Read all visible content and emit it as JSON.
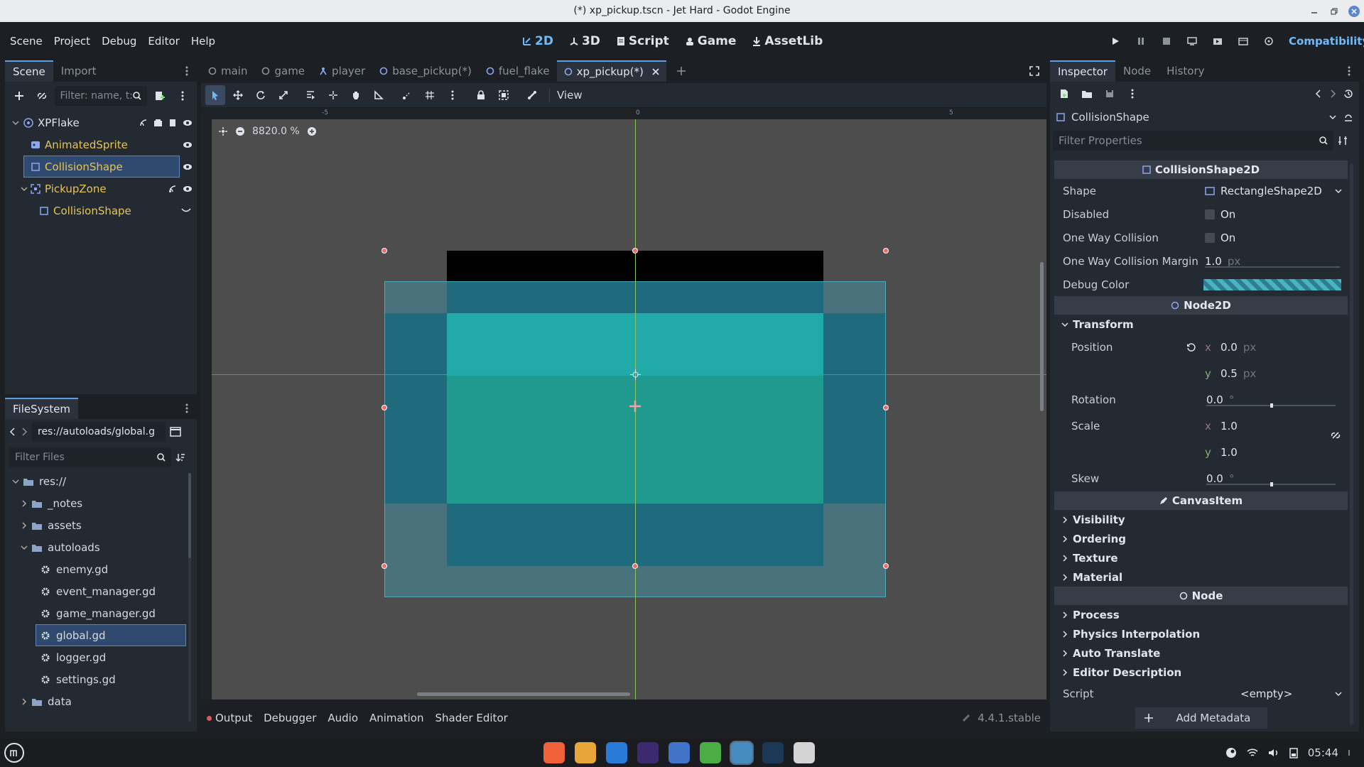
{
  "window": {
    "title": "(*) xp_pickup.tscn - Jet Hard - Godot Engine"
  },
  "menu": [
    "Scene",
    "Project",
    "Debug",
    "Editor",
    "Help"
  ],
  "workspaces": [
    {
      "label": "2D",
      "active": true
    },
    {
      "label": "3D",
      "active": false
    },
    {
      "label": "Script",
      "active": false
    },
    {
      "label": "Game",
      "active": false
    },
    {
      "label": "AssetLib",
      "active": false
    }
  ],
  "renderer": "Compatibility",
  "scene_dock": {
    "tabs": [
      "Scene",
      "Import"
    ],
    "filter_placeholder": "Filter: name, t:",
    "nodes": [
      {
        "label": "XPFlake",
        "color": "#dfe3ea"
      },
      {
        "label": "AnimatedSprite",
        "color": "#e5c456"
      },
      {
        "label": "CollisionShape",
        "color": "#e5c456"
      },
      {
        "label": "PickupZone",
        "color": "#e5c456"
      },
      {
        "label": "CollisionShape",
        "color": "#e5c456"
      }
    ]
  },
  "filesystem": {
    "tab": "FileSystem",
    "path": "res://autoloads/global.g",
    "filter_placeholder": "Filter Files",
    "items": [
      "res://",
      "_notes",
      "assets",
      "autoloads",
      "enemy.gd",
      "event_manager.gd",
      "game_manager.gd",
      "global.gd",
      "logger.gd",
      "settings.gd",
      "data"
    ]
  },
  "editor_tabs": [
    {
      "label": "main",
      "active": false
    },
    {
      "label": "game",
      "active": false
    },
    {
      "label": "player",
      "active": false
    },
    {
      "label": "base_pickup(*)",
      "active": false
    },
    {
      "label": "fuel_flake",
      "active": false
    },
    {
      "label": "xp_pickup(*)",
      "active": true
    }
  ],
  "viewport": {
    "view_label": "View",
    "zoom": "8820.0 %",
    "ruler_labels": [
      "-5",
      "0",
      "5"
    ]
  },
  "bottom_panel": {
    "tabs": [
      "Output",
      "Debugger",
      "Audio",
      "Animation",
      "Shader Editor"
    ],
    "version": "4.4.1.stable"
  },
  "inspector": {
    "tabs": [
      "Inspector",
      "Node",
      "History"
    ],
    "object": "CollisionShape",
    "filter_placeholder": "Filter Properties",
    "class_collision": "CollisionShape2D",
    "shape_label": "Shape",
    "shape_value": "RectangleShape2D",
    "disabled_label": "Disabled",
    "oneway_label": "One Way Collision",
    "on_text": "On",
    "margin_label": "One Way Collision Margin",
    "margin_value": "1.0",
    "unit_px": "px",
    "debug_color_label": "Debug Color",
    "class_node2d": "Node2D",
    "transform_label": "Transform",
    "position_label": "Position",
    "pos_x": "0.0",
    "pos_y": "0.5",
    "rotation_label": "Rotation",
    "rotation_value": "0.0",
    "degree": "°",
    "scale_label": "Scale",
    "scale_x": "1.0",
    "scale_y": "1.0",
    "skew_label": "Skew",
    "skew_value": "0.0",
    "axis_x": "x",
    "axis_y": "y",
    "class_canvas": "CanvasItem",
    "canvas_groups": [
      "Visibility",
      "Ordering",
      "Texture",
      "Material"
    ],
    "class_nodebase": "Node",
    "node_groups": [
      "Process",
      "Physics Interpolation",
      "Auto Translate",
      "Editor Description"
    ],
    "script_label": "Script",
    "script_value": "<empty>",
    "add_metadata": "Add Metadata"
  },
  "taskbar": {
    "clock": "05:44"
  },
  "colors": {
    "accent": "#70bafa",
    "node_label": "#e5c456",
    "pixel_black": "#000000",
    "pixel_teal_light": "#00b59c",
    "pixel_green": "#00956e",
    "pixel_dark": "#003e4f",
    "collision_overlay": "#2d6e7c"
  }
}
